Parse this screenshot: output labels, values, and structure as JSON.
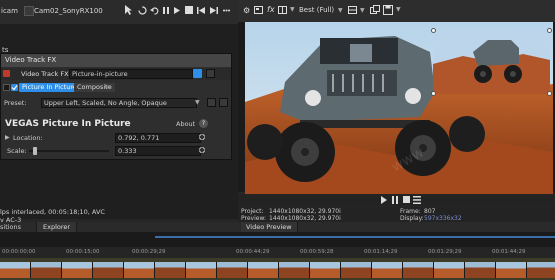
{
  "left_top": {
    "tab_left": "icam",
    "tab_file": "Cam02_SonyRX100",
    "side_label": "ts"
  },
  "fx_window": {
    "title": "Video Track FX",
    "chain_label": "Video Track FX:",
    "chain_value": "Picture-in-picture",
    "plugin_pip": "Picture In Picture",
    "plugin_composite": "Composite",
    "preset_label": "Preset:",
    "preset_value": "Upper Left, Scaled, No Angle, Opaque",
    "plugin_title": "VEGAS Picture In Picture",
    "about_label": "About",
    "help_label": "?",
    "location_label": "Location:",
    "location_value": "0.792, 0.771",
    "scale_label": "Scale:",
    "scale_value": "0.333",
    "scale_level": 0.05
  },
  "left_status": {
    "line1": "lps interlaced, 00:05:18;10, AVC",
    "line2": "y AC-3"
  },
  "left_tabs": {
    "positions": "sitions",
    "explorer": "Explorer"
  },
  "preview_toolbar": {
    "quality": "Best (Full)"
  },
  "preview_info": {
    "project_label": "Project:",
    "project_value": "1440x1080x32, 29.970i",
    "preview_label": "Preview:",
    "preview_value": "1440x1080x32, 29.970i",
    "frame_label": "Frame:",
    "frame_value": "807",
    "display_label": "Display:",
    "display_value": "597x336x32"
  },
  "preview_tab": "Video Preview",
  "timeline": {
    "ticks": [
      "00:00:00;00",
      "00:00:15;00",
      "00:00:29;29",
      "00:00:44;29",
      "00:00:59;28",
      "00:01:14;29",
      "00:01:29;29",
      "00:01:44;29",
      "00:01:59;28"
    ],
    "side_ticks": [
      "00:00:00;00",
      "00:00:15;00",
      "00:00:29;29"
    ]
  },
  "colors": {
    "accent": "#2d8fe8",
    "display_value": "#7a8fd0"
  }
}
